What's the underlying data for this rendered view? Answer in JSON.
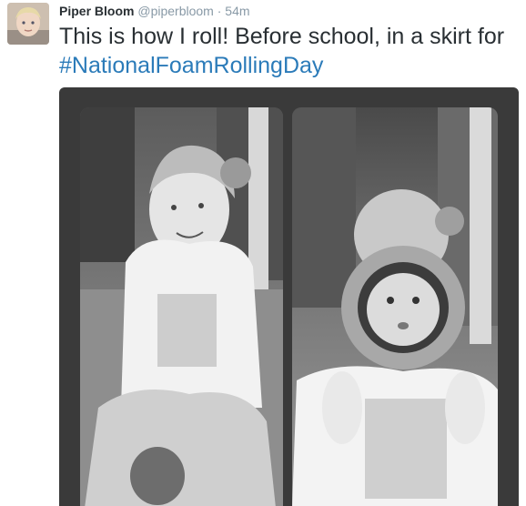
{
  "tweet": {
    "author_name": "Piper Bloom",
    "author_handle": "@piperbloom",
    "separator": "·",
    "timestamp": "54m",
    "text_main": "This is how I roll! Before school, in a skirt for ",
    "hashtag": "#NationalFoamRollingDay"
  },
  "media": {
    "photos": [
      "photo-left",
      "photo-right"
    ]
  },
  "colors": {
    "name": "#292f33",
    "meta": "#8899a6",
    "hashtag": "#2b7bb9",
    "frame": "#3a3a3a"
  }
}
